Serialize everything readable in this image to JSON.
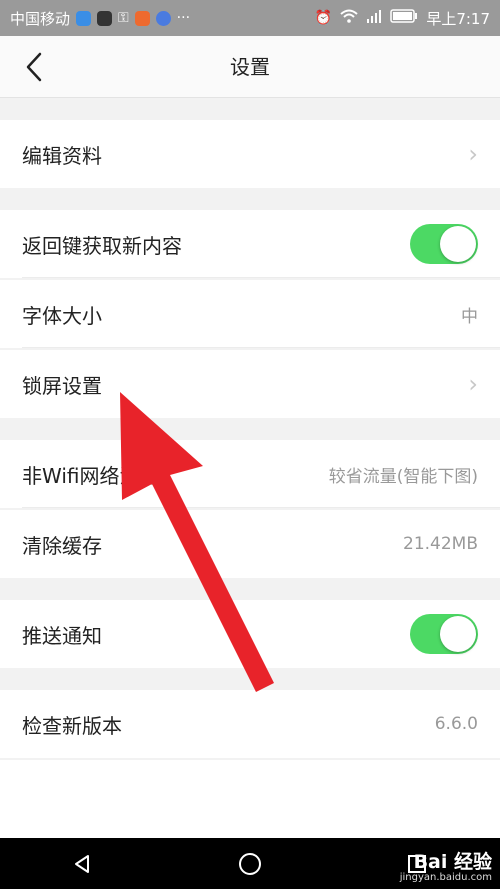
{
  "status_bar": {
    "carrier": "中国移动",
    "time": "早上7:17",
    "app_icon_colors": [
      "#3a8ee6",
      "#333333",
      "#ee6a2f",
      "#4a7be0"
    ]
  },
  "header": {
    "title": "设置"
  },
  "rows": {
    "edit_profile": {
      "label": "编辑资料"
    },
    "back_key_refresh": {
      "label": "返回键获取新内容",
      "toggle_on": true
    },
    "font_size": {
      "label": "字体大小",
      "value": "中"
    },
    "lock_screen": {
      "label": "锁屏设置"
    },
    "non_wifi": {
      "label": "非Wifi网络流量",
      "value": "较省流量(智能下图)"
    },
    "clear_cache": {
      "label": "清除缓存",
      "value": "21.42MB"
    },
    "push": {
      "label": "推送通知",
      "toggle_on": true
    },
    "version": {
      "label": "检查新版本",
      "value": "6.6.0"
    }
  },
  "watermark": {
    "brand": "Bai 经验",
    "site": "jingyan.baidu.com"
  },
  "colors": {
    "toggle": "#4cd964",
    "annotation_arrow": "#e8232a"
  },
  "icons": [
    "back-chevron-icon",
    "chevron-right-icon",
    "nav-back-icon",
    "nav-home-icon",
    "nav-recent-icon"
  ]
}
